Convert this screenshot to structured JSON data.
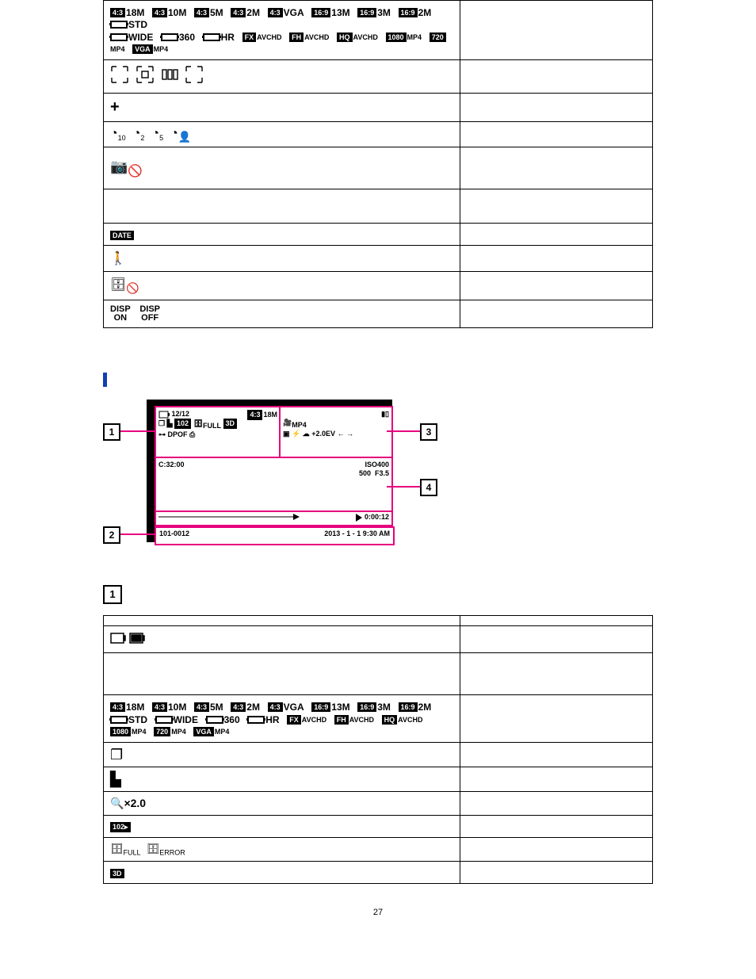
{
  "page_number": "27",
  "table1": {
    "row_imgsize": {
      "badges43": "4:3",
      "sizes43": [
        "18M",
        "10M",
        "5M",
        "2M",
        "VGA"
      ],
      "badges169": "16:9",
      "sizes169": [
        "13M",
        "3M",
        "2M"
      ],
      "pano": [
        "STD",
        "WIDE",
        "360",
        "HR"
      ],
      "mov": [
        {
          "b": "FX",
          "t": "AVCHD"
        },
        {
          "b": "FH",
          "t": "AVCHD"
        },
        {
          "b": "HQ",
          "t": "AVCHD"
        },
        {
          "b": "1080",
          "t": "MP4"
        },
        {
          "b": "720",
          "t": "MP4"
        },
        {
          "b": "VGA",
          "t": "MP4"
        }
      ]
    },
    "row_disp": {
      "on": "DISP\nON",
      "off": "DISP\nOFF"
    },
    "row_date_badge": "DATE",
    "row_zoom": "",
    "row_timer_subs": [
      "10",
      "2",
      "5",
      ""
    ]
  },
  "section_title": "",
  "diagram": {
    "fr1": {
      "count": "12/12",
      "size_b": "4:3",
      "size": "18M",
      "icons": "DPOF",
      "folder": "102"
    },
    "fr3": {
      "mp4": "MP4",
      "ev": "+2.0EV"
    },
    "fr4": {
      "c": "C:32:00",
      "iso": "ISO400",
      "sp": "500",
      "fn": "F3.5"
    },
    "progress": "0:00:12",
    "fr2": {
      "file": "101-0012",
      "dt": "2013 - 1 - 1   9:30 AM"
    },
    "callouts": [
      "1",
      "2",
      "3",
      "4"
    ]
  },
  "section1_callout": "1",
  "table2": {
    "head_left": "",
    "head_right": "",
    "row_imgsize": {
      "badges43": "4:3",
      "sizes43": [
        "18M",
        "10M",
        "5M",
        "2M",
        "VGA"
      ],
      "badges169": "16:9",
      "sizes169": [
        "13M",
        "3M",
        "2M"
      ],
      "pano": [
        "STD",
        "WIDE",
        "360",
        "HR"
      ],
      "mov": [
        {
          "b": "FX",
          "t": "AVCHD"
        },
        {
          "b": "FH",
          "t": "AVCHD"
        },
        {
          "b": "HQ",
          "t": "AVCHD"
        },
        {
          "b": "1080",
          "t": "MP4"
        },
        {
          "b": "720",
          "t": "MP4"
        },
        {
          "b": "VGA",
          "t": "MP4"
        }
      ]
    },
    "row_zoom": "×2.0",
    "row_folder": "102",
    "row_db": {
      "full": "FULL",
      "err": "ERROR"
    },
    "row_3d": "3D"
  }
}
